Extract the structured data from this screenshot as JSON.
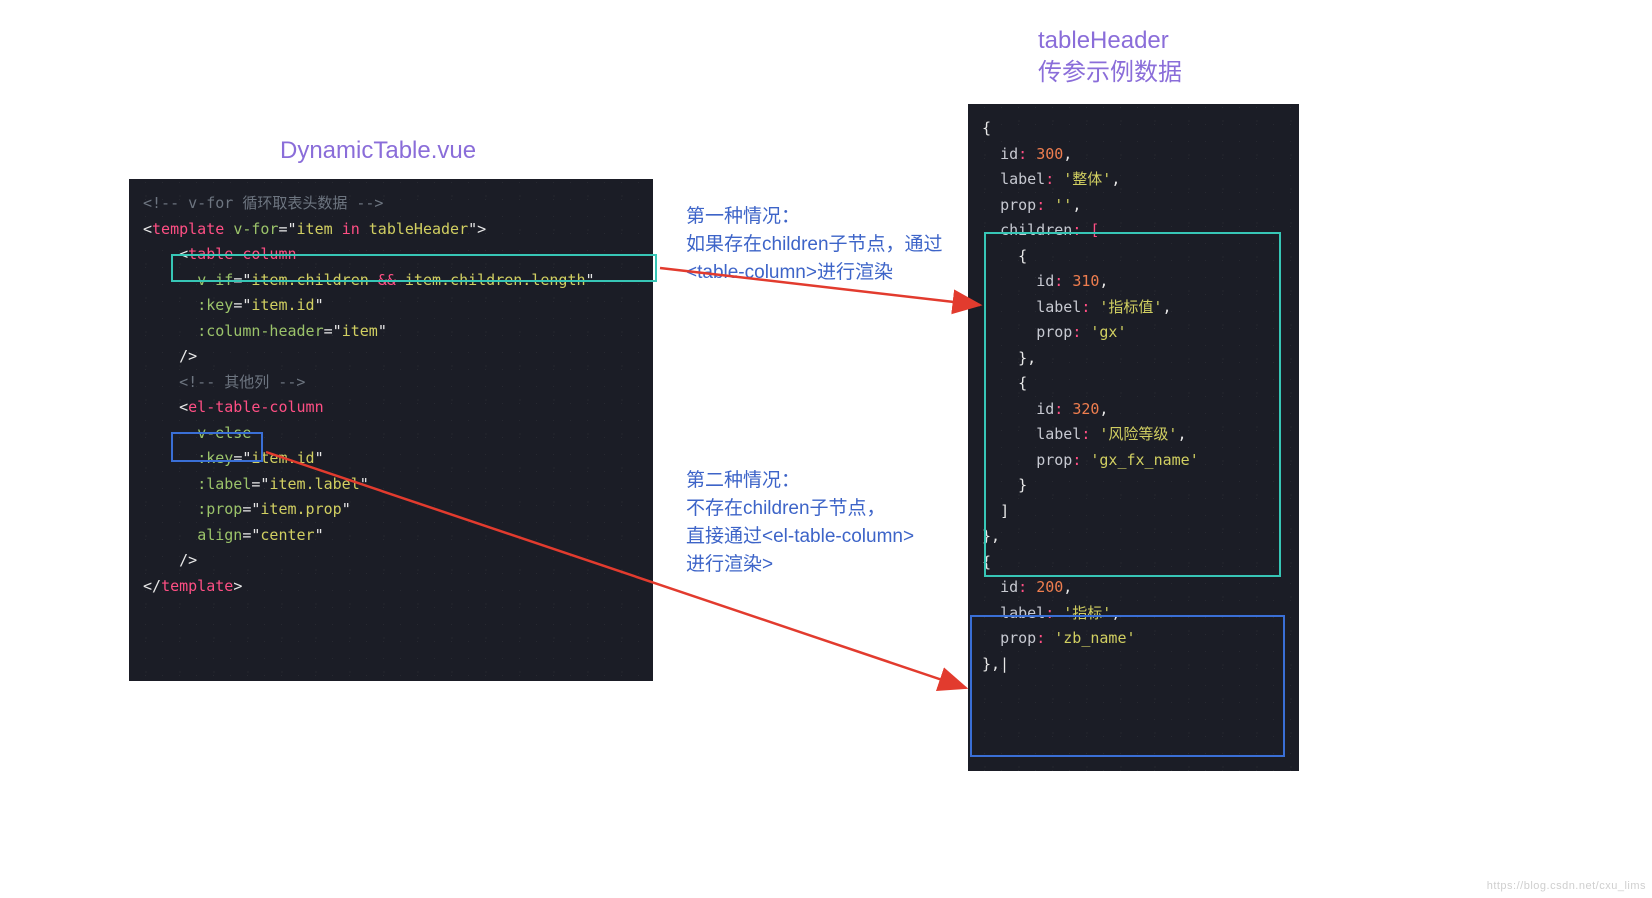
{
  "leftTitle": "DynamicTable.vue",
  "rightTitle": "tableHeader\n传参示例数据",
  "caption1": "第一种情况：\n如果存在children子节点，通过\n<table-column>进行渲染",
  "caption2": "第二种情况：\n不存在children子节点，\n直接通过<el-table-column>\n进行渲染>",
  "watermark": "https://blog.csdn.net/cxu_lims",
  "leftCode": {
    "l1": {
      "full": "<!-- v-for 循环取表头数据 -->"
    },
    "l2": {
      "p1": "<",
      "tag": "template",
      "sp": " ",
      "attr": "v-for",
      "eq": "=\"",
      "sA": "item ",
      "op": "in",
      "sB": " tableHeader",
      "eq2": "\"",
      "p2": ">"
    },
    "l3": {
      "pad": "    ",
      "p1": "<",
      "tag": "table-column"
    },
    "l4": {
      "pad": "      ",
      "attr": "v-if",
      "eq": "=\"",
      "sA": "item.children ",
      "op": "&&",
      "sB": " item.children.length",
      "eq2": "\""
    },
    "l5": {
      "pad": "      ",
      "attr": ":key",
      "eq": "=\"",
      "s": "item.id",
      "eq2": "\""
    },
    "l6": {
      "pad": "      ",
      "attr": ":column-header",
      "eq": "=\"",
      "s": "item",
      "eq2": "\""
    },
    "l7": {
      "pad": "    ",
      "p": "/>"
    },
    "l8": {
      "pad": "    ",
      "full": "<!-- 其他列 -->"
    },
    "l9": {
      "pad": "    ",
      "p1": "<",
      "tag": "el-table-column"
    },
    "l10": {
      "pad": "      ",
      "attr": "v-else"
    },
    "l11": {
      "pad": "      ",
      "attr": ":key",
      "eq": "=\"",
      "s": "item.id",
      "eq2": "\""
    },
    "l12": {
      "pad": "      ",
      "attr": ":label",
      "eq": "=\"",
      "s": "item.label",
      "eq2": "\""
    },
    "l13": {
      "pad": "      ",
      "attr": ":prop",
      "eq": "=\"",
      "s": "item.prop",
      "eq2": "\""
    },
    "l14": {
      "pad": "      ",
      "attr": "align",
      "eq": "=\"",
      "s": "center",
      "eq2": "\""
    },
    "l15": {
      "pad": "    ",
      "p": "/>"
    },
    "l16": {
      "p1": "</",
      "tag": "template",
      "p2": ">"
    }
  },
  "rightCode": {
    "r1": {
      "t": "{"
    },
    "r2": {
      "pad": "  ",
      "k": "id",
      "c": ": ",
      "n": "300",
      "e": ","
    },
    "r3": {
      "pad": "  ",
      "k": "label",
      "c": ": ",
      "s": "'整体'",
      "e": ","
    },
    "r4": {
      "pad": "  ",
      "k": "prop",
      "c": ": ",
      "s": "''",
      "e": ","
    },
    "r5": {
      "pad": "  ",
      "k": "children",
      "c": ": [",
      "e": ""
    },
    "r6": {
      "pad": "    ",
      "t": "{"
    },
    "r7": {
      "pad": "      ",
      "k": "id",
      "c": ": ",
      "n": "310",
      "e": ","
    },
    "r8": {
      "pad": "      ",
      "k": "label",
      "c": ": ",
      "s": "'指标值'",
      "e": ","
    },
    "r9": {
      "pad": "      ",
      "k": "prop",
      "c": ": ",
      "s": "'gx'"
    },
    "r10": {
      "pad": "    ",
      "t": "},"
    },
    "r11": {
      "pad": "    ",
      "t": "{"
    },
    "r12": {
      "pad": "      ",
      "k": "id",
      "c": ": ",
      "n": "320",
      "e": ","
    },
    "r13": {
      "pad": "      ",
      "k": "label",
      "c": ": ",
      "s": "'风险等级'",
      "e": ","
    },
    "r14": {
      "pad": "      ",
      "k": "prop",
      "c": ": ",
      "s": "'gx_fx_name'"
    },
    "r15": {
      "pad": "    ",
      "t": "}"
    },
    "r16": {
      "pad": "  ",
      "t": "]"
    },
    "r17": {
      "t": "},"
    },
    "r18": {
      "t": "{"
    },
    "r19": {
      "pad": "  ",
      "k": "id",
      "c": ": ",
      "n": "200",
      "e": ","
    },
    "r20": {
      "pad": "  ",
      "k": "label",
      "c": ": ",
      "s": "'指标'",
      "e": ","
    },
    "r21": {
      "pad": "  ",
      "k": "prop",
      "c": ": ",
      "s": "'zb_name'"
    },
    "r22": {
      "t": "},|"
    }
  },
  "tableHeaderData": [
    {
      "id": 300,
      "label": "整体",
      "prop": "",
      "children": [
        {
          "id": 310,
          "label": "指标值",
          "prop": "gx"
        },
        {
          "id": 320,
          "label": "风险等级",
          "prop": "gx_fx_name"
        }
      ]
    },
    {
      "id": 200,
      "label": "指标",
      "prop": "zb_name"
    }
  ]
}
